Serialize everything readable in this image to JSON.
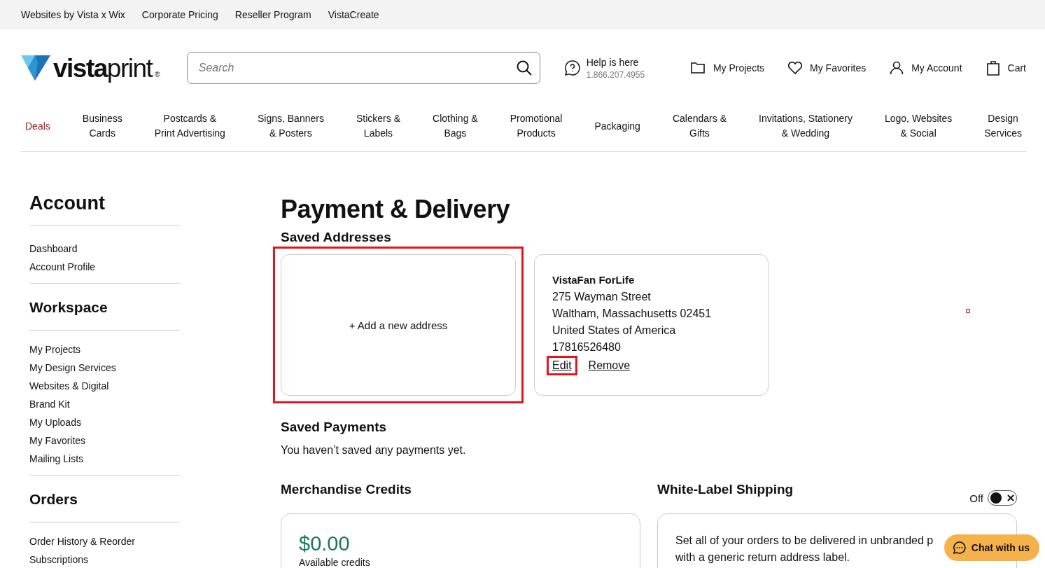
{
  "top_links": [
    "Websites by Vista x Wix",
    "Corporate Pricing",
    "Reseller Program",
    "VistaCreate"
  ],
  "logo": {
    "bold": "vista",
    "light": "print",
    "mark": "®"
  },
  "search": {
    "placeholder": "Search"
  },
  "help": {
    "title": "Help is here",
    "phone": "1.866.207.4955"
  },
  "header_links": [
    {
      "kind": "folder",
      "label": "My Projects"
    },
    {
      "kind": "heart",
      "label": "My Favorites"
    },
    {
      "kind": "person",
      "label": "My Account"
    },
    {
      "kind": "bag",
      "label": "Cart"
    }
  ],
  "nav": [
    {
      "label": "Deals",
      "kind": "deal"
    },
    {
      "label": "Business Cards",
      "kind": "normal"
    },
    {
      "label": "Postcards & Print Advertising",
      "kind": "normal"
    },
    {
      "label": "Signs, Banners & Posters",
      "kind": "normal"
    },
    {
      "label": "Stickers & Labels",
      "kind": "normal"
    },
    {
      "label": "Clothing & Bags",
      "kind": "normal"
    },
    {
      "label": "Promotional Products",
      "kind": "normal"
    },
    {
      "label": "Packaging",
      "kind": "normal"
    },
    {
      "label": "Calendars & Gifts",
      "kind": "normal"
    },
    {
      "label": "Invitations, Stationery & Wedding",
      "kind": "normal"
    },
    {
      "label": "Logo, Websites & Social",
      "kind": "normal"
    },
    {
      "label": "Design Services",
      "kind": "normal"
    }
  ],
  "sidebar": [
    {
      "title": "Account",
      "items": [
        "Dashboard",
        "Account Profile"
      ]
    },
    {
      "title": "Workspace",
      "items": [
        "My Projects",
        "My Design Services",
        "Websites & Digital",
        "Brand Kit",
        "My Uploads",
        "My Favorites",
        "Mailing Lists"
      ]
    },
    {
      "title": "Orders",
      "items": [
        "Order History & Reorder",
        "Subscriptions"
      ]
    }
  ],
  "page_title": "Payment & Delivery",
  "saved_addresses": {
    "title": "Saved Addresses",
    "add": {
      "label": "+ Add a new address",
      "highlighted": true
    },
    "addresses": [
      {
        "name": "VistaFan ForLife",
        "lines": [
          "275 Wayman Street",
          "Waltham, Massachusetts 02451",
          "United States of America",
          "17816526480"
        ],
        "edit": {
          "label": "Edit",
          "highlighted": true
        },
        "remove": {
          "label": "Remove",
          "highlighted": false
        }
      }
    ]
  },
  "saved_payments": {
    "title": "Saved Payments",
    "message": "You haven’t saved any payments yet."
  },
  "merchandise_credits": {
    "title": "Merchandise Credits",
    "amount": "$0.00",
    "caption": "Available credits"
  },
  "white_label": {
    "title": "White-Label Shipping",
    "toggle_label": "Off",
    "on": false,
    "text": "Set all of your orders to be delivered in unbranded p",
    "text2": "with a generic return address label."
  },
  "chat": {
    "label": "Chat with us"
  }
}
